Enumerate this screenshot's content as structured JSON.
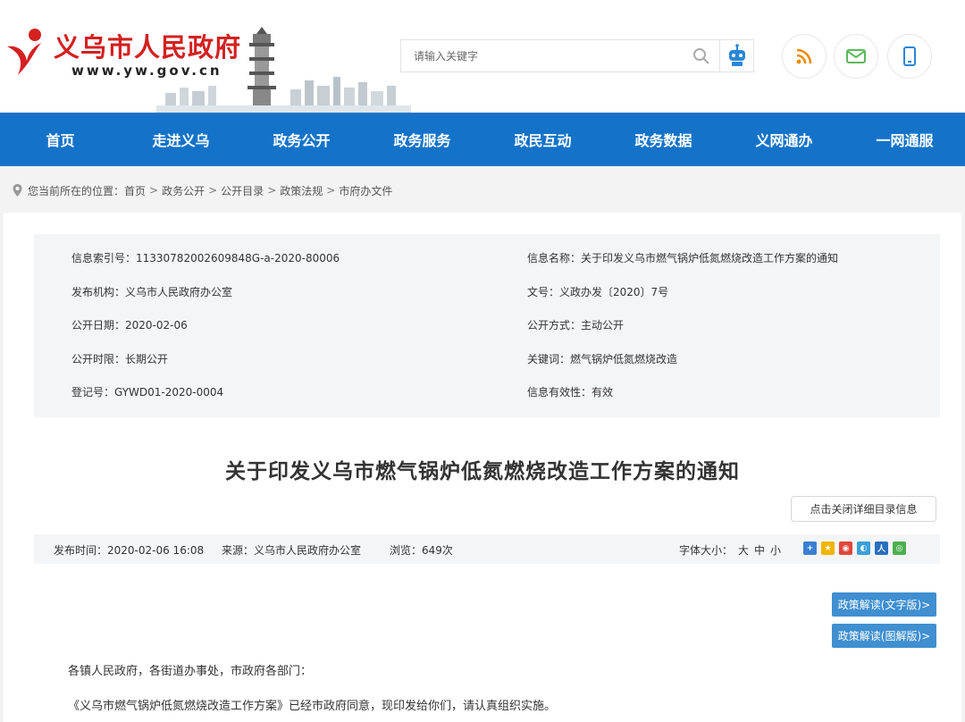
{
  "header": {
    "site_name": "义乌市人民政府",
    "site_url": "www.yw.gov.cn",
    "search_placeholder": "请输入关键字",
    "accent_color": "#d42020",
    "icons": [
      "logo-mark",
      "search-icon",
      "robot-icon",
      "rss-icon",
      "mail-icon",
      "mobile-icon"
    ]
  },
  "nav": {
    "color": "#1473c9",
    "items": [
      {
        "label": "首页"
      },
      {
        "label": "走进义乌"
      },
      {
        "label": "政务公开"
      },
      {
        "label": "政务服务"
      },
      {
        "label": "政民互动"
      },
      {
        "label": "政务数据"
      },
      {
        "label": "义网通办"
      },
      {
        "label": "一网通服"
      }
    ]
  },
  "breadcrumb": {
    "prefix": "您当前所在的位置：",
    "items": [
      "首页",
      "政务公开",
      "公开目录",
      "政策法规",
      "市府办文件"
    ],
    "separator": ">"
  },
  "info": {
    "index_no": "信息索引号：11330782002609848G-a-2020-80006",
    "name": "信息名称：关于印发义乌市燃气锅炉低氮燃烧改造工作方案的通知",
    "publisher": "发布机构：义乌市人民政府办公室",
    "doc_no": "文号：义政办发〔2020〕7号",
    "open_date": "公开日期：2020-02-06",
    "open_mode": "公开方式：主动公开",
    "open_period": "公开时限：长期公开",
    "keywords": "关键词：燃气锅炉低氮燃烧改造",
    "reg_no": "登记号：GYWD01-2020-0004",
    "validity": "信息有效性：有效"
  },
  "article": {
    "title": "关于印发义乌市燃气锅炉低氮燃烧改造工作方案的通知",
    "toggle_catalog": "点击关闭详细目录信息",
    "publish_time": "发布时间：2020-02-06 16:08",
    "source": "来源：义乌市人民政府办公室",
    "views": "浏览：649次",
    "font_size_label": "字体大小：",
    "font_sizes": [
      "大",
      "中",
      "小"
    ],
    "interp_text": "政策解读(文字版)>",
    "interp_graphic": "政策解读(图解版)>",
    "salutation": "各镇人民政府，各街道办事处，市政府各部门：",
    "paragraph1": "《义乌市燃气锅炉低氮燃烧改造工作方案》已经市政府同意，现印发给你们，请认真组织实施。"
  },
  "share": {
    "icons": [
      "share-plus-icon",
      "qzone-icon",
      "weibo-icon",
      "tencent-weibo-icon",
      "renren-icon",
      "wechat-icon"
    ]
  }
}
